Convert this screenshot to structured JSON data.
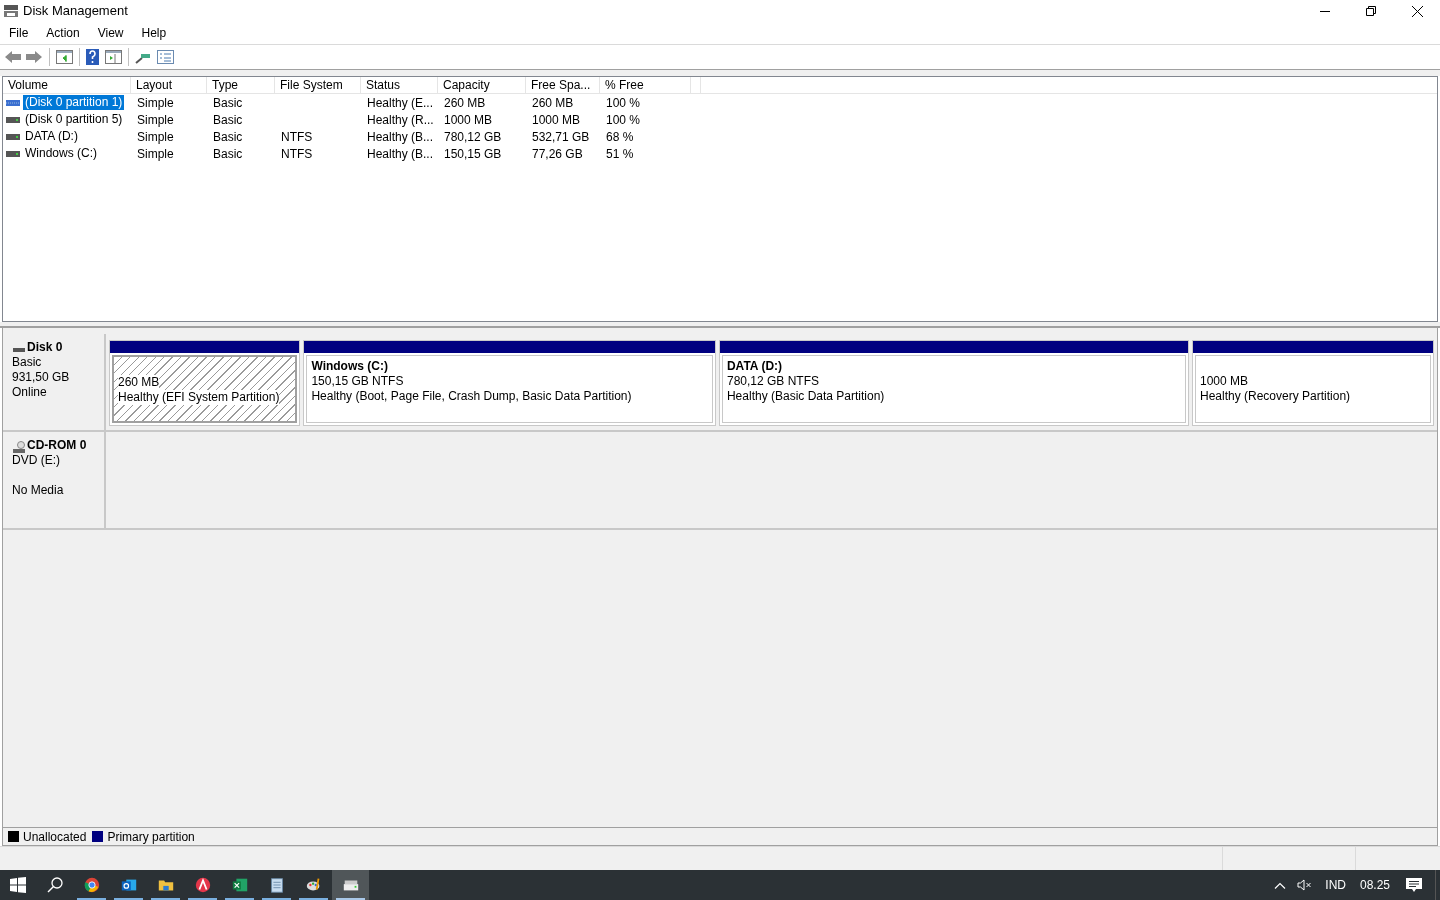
{
  "window": {
    "title": "Disk Management"
  },
  "menu": [
    "File",
    "Action",
    "View",
    "Help"
  ],
  "volume_list": {
    "columns": [
      "Volume",
      "Layout",
      "Type",
      "File System",
      "Status",
      "Capacity",
      "Free Spa...",
      "% Free"
    ],
    "rows": [
      {
        "cells": [
          "(Disk 0 partition 1)",
          "Simple",
          "Basic",
          null,
          "Healthy (E...",
          "260 MB",
          "260 MB",
          "100 %"
        ],
        "selected": true
      },
      {
        "cells": [
          "(Disk 0 partition 5)",
          "Simple",
          "Basic",
          null,
          "Healthy (R...",
          "1000 MB",
          "1000 MB",
          "100 %"
        ],
        "selected": false
      },
      {
        "cells": [
          "DATA (D:)",
          "Simple",
          "Basic",
          "NTFS",
          "Healthy (B...",
          "780,12 GB",
          "532,71 GB",
          "68 %"
        ],
        "selected": false
      },
      {
        "cells": [
          "Windows (C:)",
          "Simple",
          "Basic",
          "NTFS",
          "Healthy (B...",
          "150,15 GB",
          "77,26 GB",
          "51 %"
        ],
        "selected": false
      }
    ]
  },
  "disks": [
    {
      "kind": "disk",
      "name": "Disk 0",
      "type": "Basic",
      "size": "931,50 GB",
      "status": "Online",
      "partitions": [
        {
          "size": "260 MB",
          "status": "Healthy (EFI System Partition)",
          "selected": true
        },
        {
          "title": "Windows  (C:)",
          "size": "150,15 GB NTFS",
          "status": "Healthy (Boot, Page File, Crash Dump, Basic Data Partition)",
          "selected": false
        },
        {
          "title": "DATA  (D:)",
          "size": "780,12 GB NTFS",
          "status": "Healthy (Basic Data Partition)",
          "selected": false
        },
        {
          "size": "1000 MB",
          "status": "Healthy (Recovery Partition)",
          "selected": false
        }
      ]
    },
    {
      "kind": "cdrom",
      "name": "CD-ROM 0",
      "type": "DVD (E:)",
      "status": "No Media"
    }
  ],
  "legend": [
    {
      "label": "Unallocated",
      "color": "#000000"
    },
    {
      "label": "Primary partition",
      "color": "#000080"
    }
  ],
  "taskbar": {
    "apps": [
      {
        "kind": "browser",
        "running": true,
        "active": false
      },
      {
        "kind": "mail",
        "running": true,
        "active": false
      },
      {
        "kind": "folder",
        "running": true,
        "active": false
      },
      {
        "kind": "red-app",
        "running": true,
        "active": false
      },
      {
        "kind": "spreadsheet",
        "running": true,
        "active": false
      },
      {
        "kind": "notepad",
        "running": true,
        "active": false
      },
      {
        "kind": "paint",
        "running": true,
        "active": false
      },
      {
        "kind": "disk",
        "running": true,
        "active": true
      }
    ],
    "language": "IND",
    "time": "08.25"
  }
}
